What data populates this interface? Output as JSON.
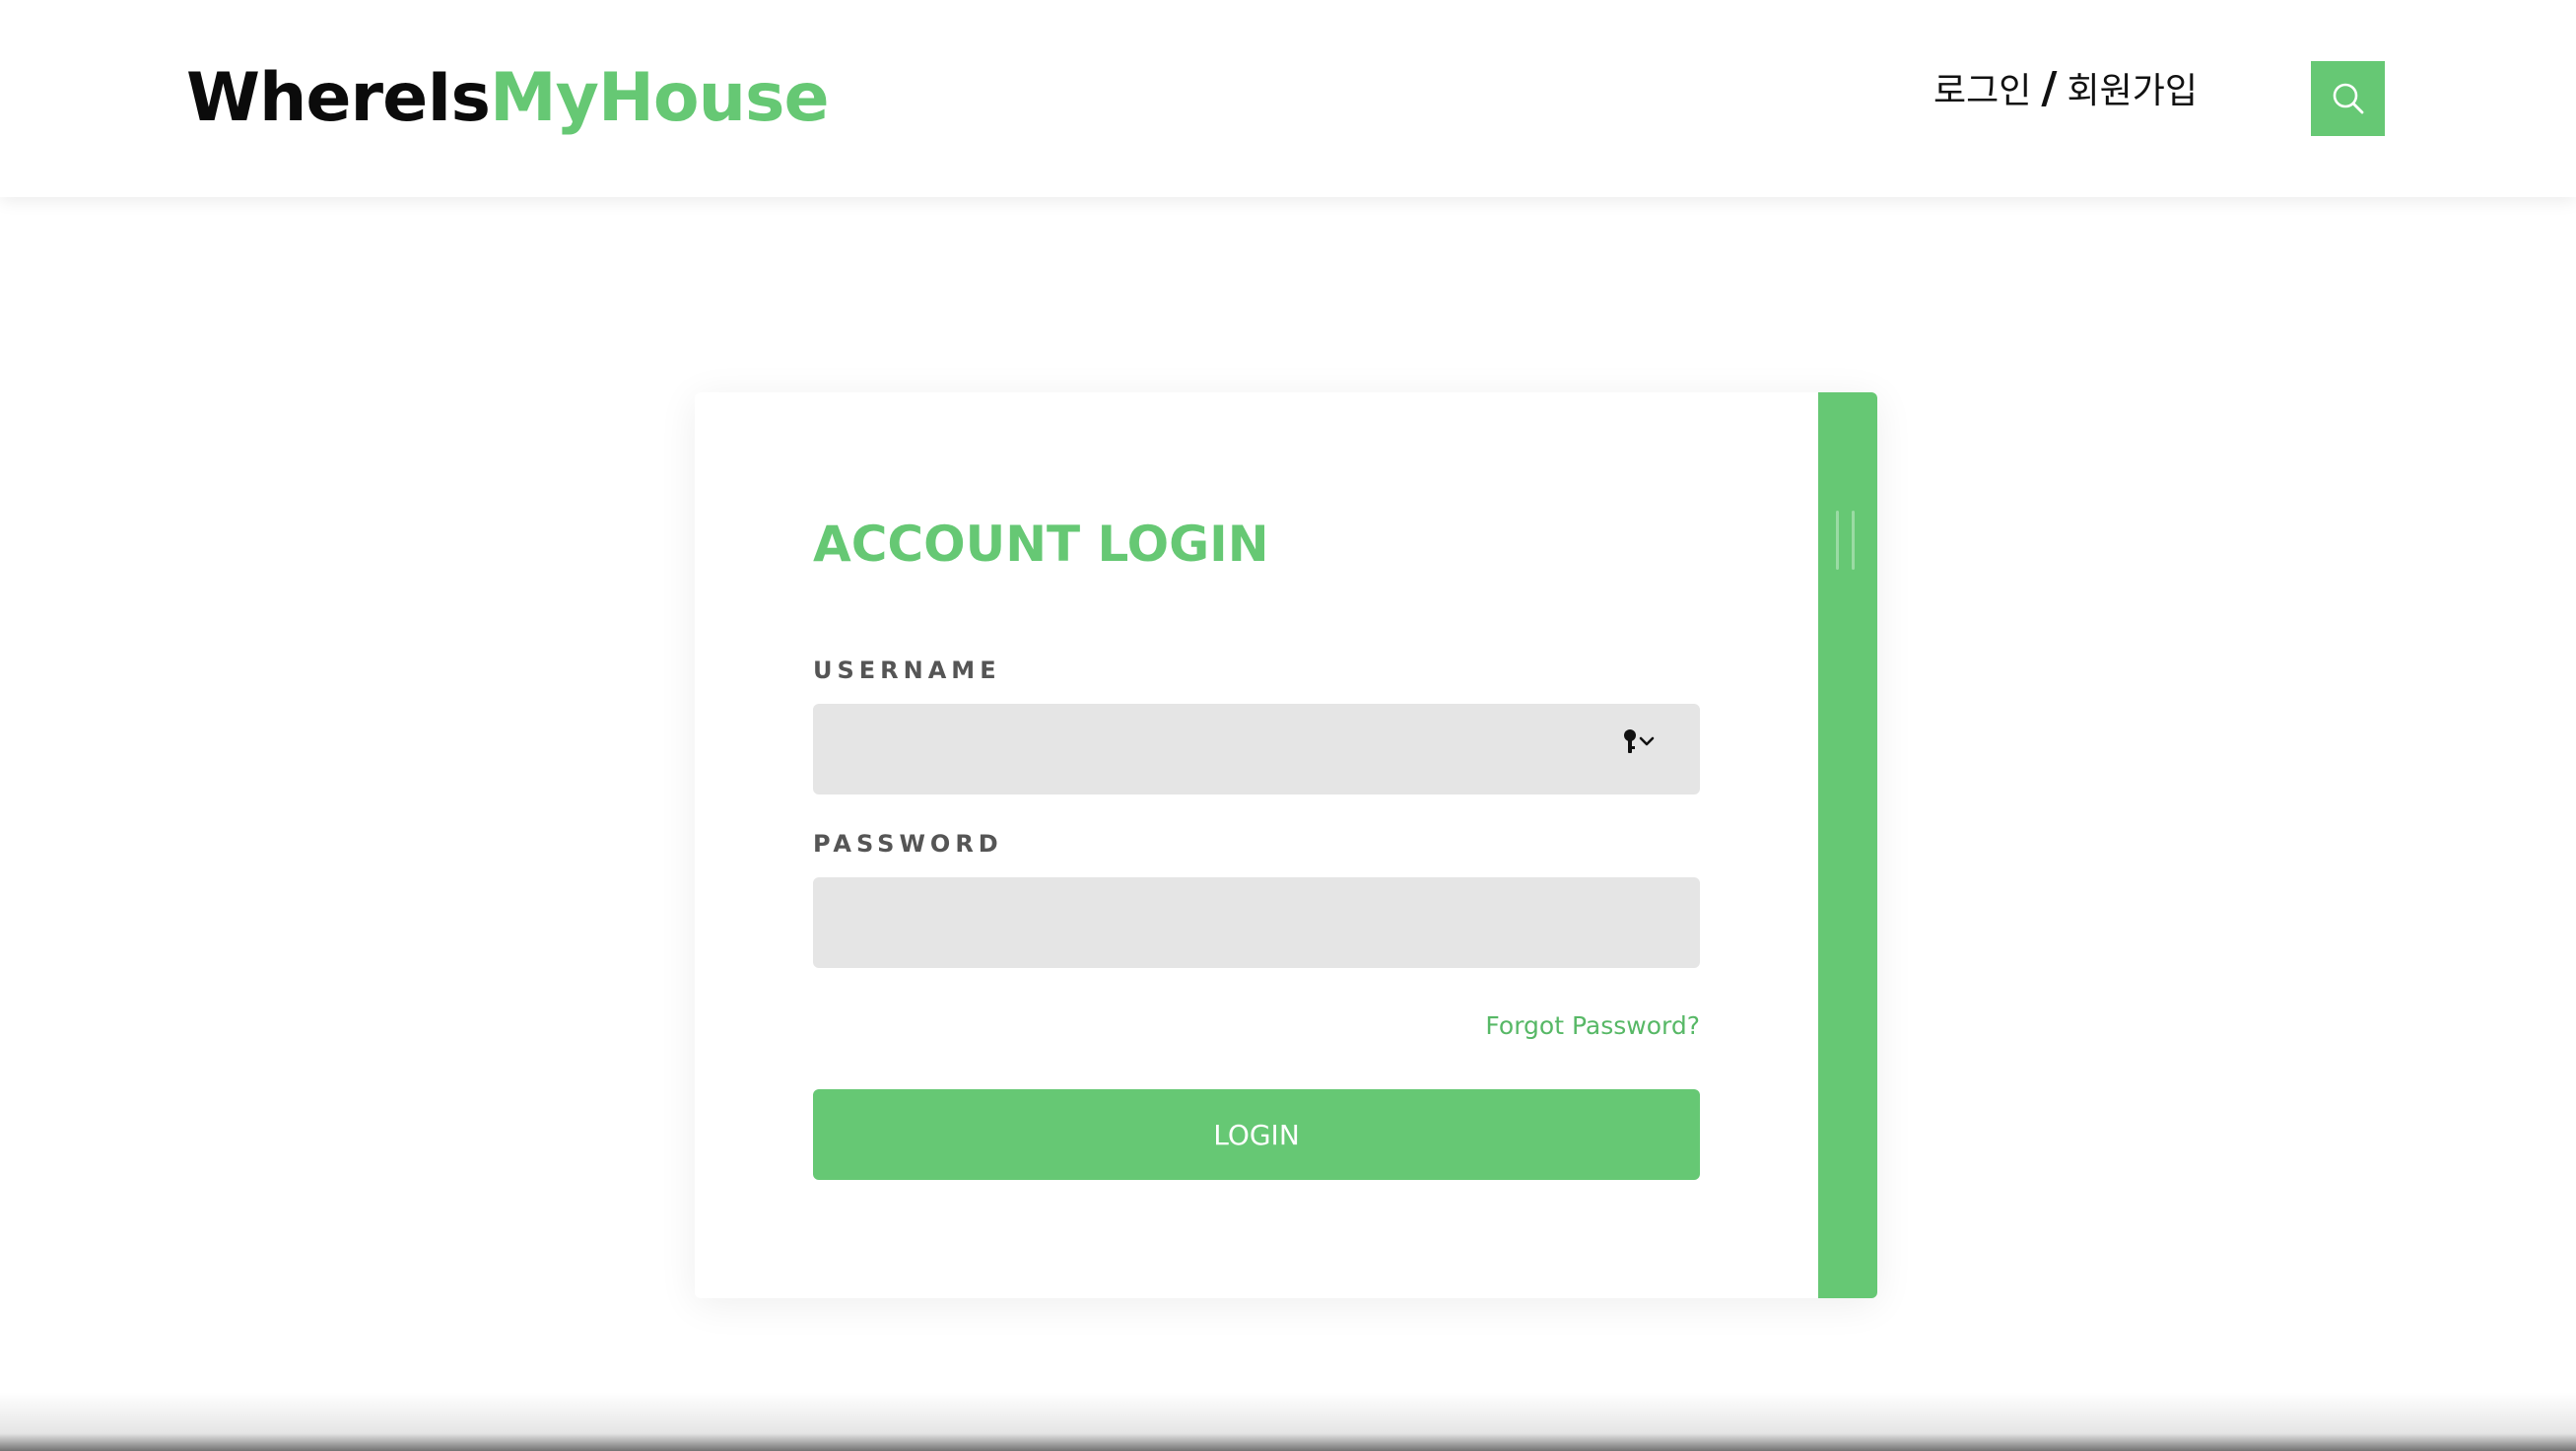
{
  "header": {
    "logo_part1": "WhereIs",
    "logo_part2": "MyHouse",
    "login_link": "로그인",
    "separator": "/",
    "signup_link": "회원가입",
    "search_icon": "search-icon"
  },
  "login": {
    "title": "ACCOUNT LOGIN",
    "username_label": "USERNAME",
    "username_value": "",
    "password_label": "PASSWORD",
    "password_value": "",
    "forgot_label": "Forgot Password?",
    "login_button": "LOGIN",
    "autofill_icon": "key-icon"
  },
  "colors": {
    "accent": "#66c874",
    "input_bg": "#e5e5e5",
    "text_dark": "#0b0b0b",
    "label": "#555555"
  }
}
